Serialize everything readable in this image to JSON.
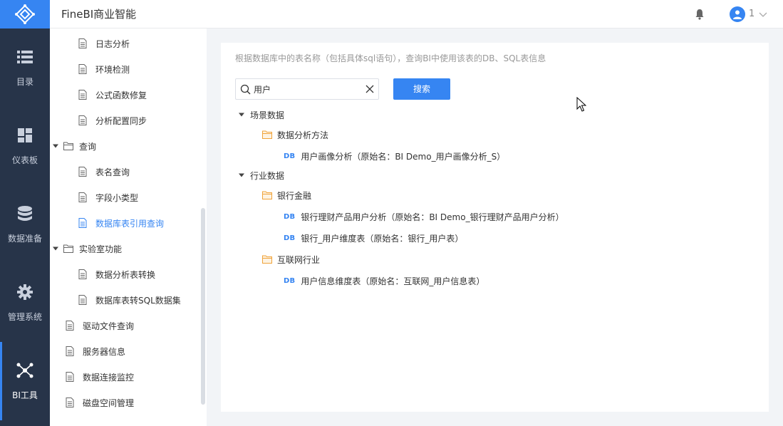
{
  "app": {
    "title": "FineBI商业智能"
  },
  "header": {
    "user_name": "1"
  },
  "rail": {
    "items": [
      {
        "label": "目录",
        "icon": "list-icon"
      },
      {
        "label": "仪表板",
        "icon": "dashboard-icon"
      },
      {
        "label": "数据准备",
        "icon": "database-icon"
      },
      {
        "label": "管理系统",
        "icon": "gear-icon"
      },
      {
        "label": "BI工具",
        "icon": "network-icon",
        "active": true
      }
    ]
  },
  "tree": {
    "items": [
      {
        "label": "日志分析",
        "kind": "doc",
        "level": 2
      },
      {
        "label": "环境检测",
        "kind": "doc",
        "level": 2
      },
      {
        "label": "公式函数修复",
        "kind": "doc",
        "level": 2
      },
      {
        "label": "分析配置同步",
        "kind": "doc",
        "level": 2
      },
      {
        "label": "查询",
        "kind": "folder",
        "level": 1,
        "expanded": true
      },
      {
        "label": "表名查询",
        "kind": "doc",
        "level": 2
      },
      {
        "label": "字段小类型",
        "kind": "doc",
        "level": 2
      },
      {
        "label": "数据库表引用查询",
        "kind": "doc",
        "level": 2,
        "active": true
      },
      {
        "label": "实验室功能",
        "kind": "folder",
        "level": 1,
        "expanded": true
      },
      {
        "label": "数据分析表转换",
        "kind": "doc",
        "level": 2
      },
      {
        "label": "数据库表转SQL数据集",
        "kind": "doc",
        "level": 2
      },
      {
        "label": "驱动文件查询",
        "kind": "doc",
        "level": 1
      },
      {
        "label": "服务器信息",
        "kind": "doc",
        "level": 1
      },
      {
        "label": "数据连接监控",
        "kind": "doc",
        "level": 1
      },
      {
        "label": "磁盘空间管理",
        "kind": "doc",
        "level": 1
      }
    ]
  },
  "main": {
    "hint": "根据数据库中的表名称（包括具体sql语句），查询BI中使用该表的DB、SQL表信息",
    "search": {
      "value": "用户",
      "placeholder": ""
    },
    "search_button": "搜索",
    "db_tag": "DB",
    "results": [
      {
        "label": "场景数据",
        "kind": "group"
      },
      {
        "label": "数据分析方法",
        "kind": "folder"
      },
      {
        "label": "用户画像分析（原始名：BI Demo_用户画像分析_S）",
        "kind": "table"
      },
      {
        "label": "行业数据",
        "kind": "group"
      },
      {
        "label": "银行金融",
        "kind": "folder"
      },
      {
        "label": "银行理财产品用户分析（原始名：BI Demo_银行理财产品用户分析）",
        "kind": "table"
      },
      {
        "label": "银行_用户维度表（原始名：银行_用户表）",
        "kind": "table"
      },
      {
        "label": "互联网行业",
        "kind": "folder"
      },
      {
        "label": "用户信息维度表（原始名：互联网_用户信息表）",
        "kind": "table"
      }
    ]
  },
  "colors": {
    "accent": "#3685f2",
    "rail_bg": "#273449",
    "folder": "#f0a33a"
  }
}
